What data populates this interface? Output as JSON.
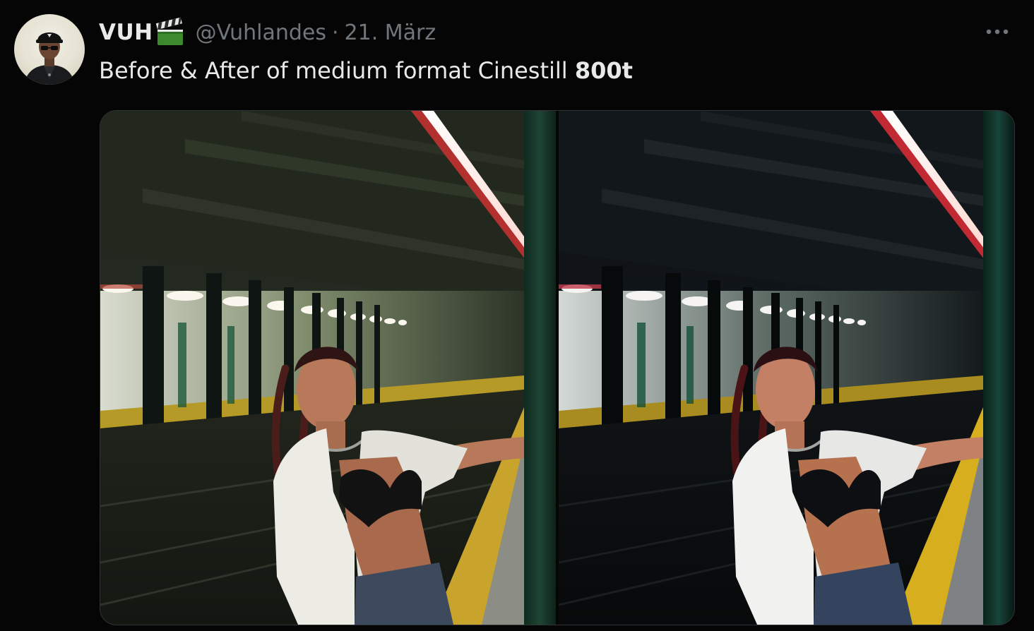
{
  "post": {
    "display_name": "VUH",
    "name_emoji": "clapper-board",
    "handle": "@Vuhlandes",
    "separator": "·",
    "date": "21. März",
    "text_prefix": "Before & After of medium format Cinestill ",
    "text_bold": "800t",
    "more_menu": "more-options"
  },
  "media": {
    "panels": [
      {
        "name": "before-photo",
        "tone": "warm-green"
      },
      {
        "name": "after-photo",
        "tone": "cool-dark"
      }
    ]
  },
  "colors": {
    "background": "#050505",
    "text_primary": "#e7e9ea",
    "text_secondary": "#71767b",
    "border": "#2f3336"
  }
}
